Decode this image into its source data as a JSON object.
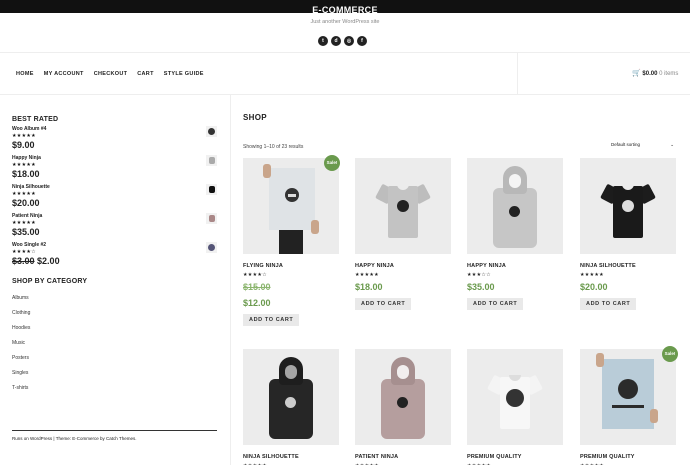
{
  "site": {
    "title": "E-COMMERCE",
    "tagline": "Just another WordPress site",
    "social_icons": [
      "twitter-icon",
      "dribbble-icon",
      "instagram-icon",
      "facebook-icon"
    ]
  },
  "nav": {
    "items": [
      "HOME",
      "MY ACCOUNT",
      "CHECKOUT",
      "CART",
      "STYLE GUIDE"
    ]
  },
  "cart": {
    "icon": "cart-icon",
    "amount": "$0.00",
    "count": "0 items"
  },
  "sidebar": {
    "best_rated_title": "BEST RATED",
    "best_rated": [
      {
        "name": "Woo Album #4",
        "stars": "★★★★★",
        "price": "$9.00",
        "old_price": ""
      },
      {
        "name": "Happy Ninja",
        "stars": "★★★★★",
        "price": "$18.00",
        "old_price": ""
      },
      {
        "name": "Ninja Silhouette",
        "stars": "★★★★★",
        "price": "$20.00",
        "old_price": ""
      },
      {
        "name": "Patient Ninja",
        "stars": "★★★★★",
        "price": "$35.00",
        "old_price": ""
      },
      {
        "name": "Woo Single #2",
        "stars": "★★★★☆",
        "price": "$2.00",
        "old_price": "$3.00"
      }
    ],
    "category_title": "SHOP BY CATEGORY",
    "categories": [
      "Albums",
      "Clothing",
      "Hoodies",
      "Music",
      "Posters",
      "Singles",
      "T-shirts"
    ]
  },
  "footer": {
    "text": "Runs on WordPress | Theme: E-Commerce by Catch Themes."
  },
  "shop": {
    "title": "SHOP",
    "result_count": "Showing 1–10 of 23 results",
    "sorting": "Default sorting",
    "add_to_cart_label": "ADD TO CART",
    "sale_badge": "Sale!",
    "products": [
      {
        "name": "FLYING NINJA",
        "stars": "★★★★☆",
        "rating": 4,
        "old_price": "$15.00",
        "price": "$12.00",
        "sale": true,
        "type": "poster"
      },
      {
        "name": "HAPPY NINJA",
        "stars": "★★★★★",
        "rating": 5,
        "old_price": "",
        "price": "$18.00",
        "sale": false,
        "type": "tee-gray"
      },
      {
        "name": "HAPPY NINJA",
        "stars": "★★★☆☆",
        "rating": 3,
        "old_price": "",
        "price": "$35.00",
        "sale": false,
        "type": "hoodie-gray"
      },
      {
        "name": "NINJA SILHOUETTE",
        "stars": "★★★★★",
        "rating": 5,
        "old_price": "",
        "price": "$20.00",
        "sale": false,
        "type": "tee-black"
      },
      {
        "name": "NINJA SILHOUETTE",
        "stars": "★★★★★",
        "rating": 5,
        "old_price": "",
        "price": "",
        "sale": false,
        "type": "hoodie-black"
      },
      {
        "name": "PATIENT NINJA",
        "stars": "★★★★★",
        "rating": 5,
        "old_price": "",
        "price": "",
        "sale": false,
        "type": "hoodie-pink"
      },
      {
        "name": "PREMIUM QUALITY",
        "stars": "★★★★★",
        "rating": 5,
        "old_price": "",
        "price": "",
        "sale": false,
        "type": "tee-white"
      },
      {
        "name": "PREMIUM QUALITY",
        "stars": "★★★★★",
        "rating": 5,
        "old_price": "",
        "price": "",
        "sale": true,
        "type": "poster-blue"
      }
    ]
  },
  "colors": {
    "accent_green": "#6a9a4d",
    "dark": "#111111",
    "card_bg": "#ececec"
  }
}
